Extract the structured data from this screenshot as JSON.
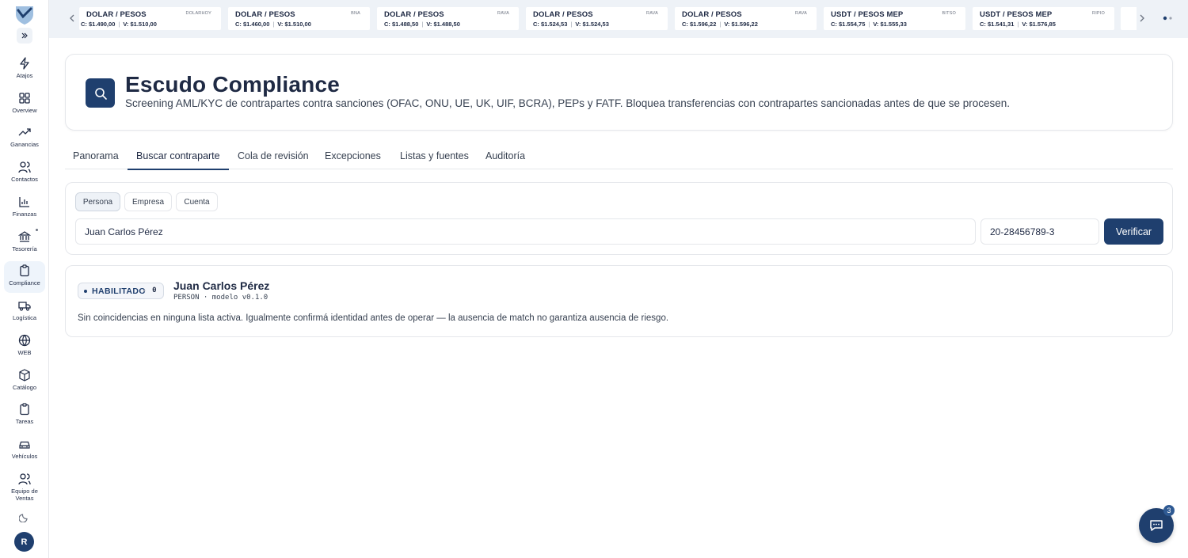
{
  "app": {
    "avatar_initial": "R",
    "accent": "#1f3f6e"
  },
  "sidebar": {
    "items": [
      {
        "label": "Atajos",
        "icon": "bolt-icon"
      },
      {
        "label": "Overview",
        "icon": "grid-icon"
      },
      {
        "label": "Ganancias",
        "icon": "trend-up-icon"
      },
      {
        "label": "Contactos",
        "icon": "users-icon"
      },
      {
        "label": "Finanzas",
        "icon": "bar-chart-icon"
      },
      {
        "label": "Tesorería",
        "icon": "bank-icon"
      },
      {
        "label": "Compliance",
        "icon": "clipboard-icon",
        "active": true
      },
      {
        "label": "Logística",
        "icon": "truck-icon"
      },
      {
        "label": "WEB",
        "icon": "globe-icon"
      },
      {
        "label": "Catálogo",
        "icon": "box-icon"
      },
      {
        "label": "Tareas",
        "icon": "clipboard-icon"
      },
      {
        "label": "Vehículos",
        "icon": "car-icon"
      },
      {
        "label": "Equipo de Ventas",
        "icon": "users-icon"
      }
    ]
  },
  "ticker": [
    {
      "pair": "DOLAR / PESOS",
      "source": "dolarhoy",
      "buy": "C: $1.490,00",
      "sell": "V: $1.510,00"
    },
    {
      "pair": "DOLAR / PESOS",
      "source": "bna",
      "buy": "C: $1.460,00",
      "sell": "V: $1.510,00"
    },
    {
      "pair": "DOLAR / PESOS",
      "source": "rava",
      "buy": "C: $1.488,50",
      "sell": "V: $1.488,50"
    },
    {
      "pair": "DOLAR / PESOS",
      "source": "rava",
      "buy": "C: $1.524,53",
      "sell": "V: $1.524,53"
    },
    {
      "pair": "DOLAR / PESOS",
      "source": "rava",
      "buy": "C: $1.596,22",
      "sell": "V: $1.596,22"
    },
    {
      "pair": "USDT / PESOS MEP",
      "source": "bitso",
      "buy": "C: $1.554,75",
      "sell": "V: $1.555,33"
    },
    {
      "pair": "USDT / PESOS MEP",
      "source": "ripio",
      "buy": "C: $1.541,31",
      "sell": "V: $1.576,85"
    }
  ],
  "header": {
    "title": "Escudo Compliance",
    "subtitle": "Screening AML/KYC de contrapartes contra sanciones (OFAC, ONU, UE, UK, UIF, BCRA), PEPs y FATF. Bloquea transferencias con contrapartes sancionadas antes de que se procesen."
  },
  "tabs": [
    "Panorama",
    "Buscar contraparte",
    "Cola de revisión",
    "Excepciones",
    "Listas y fuentes",
    "Auditoría"
  ],
  "search": {
    "types": [
      "Persona",
      "Empresa",
      "Cuenta"
    ],
    "name_value": "Juan Carlos Pérez",
    "id_value": "20-28456789-3",
    "verify_label": "Verificar"
  },
  "result": {
    "status": "HABILITADO",
    "score": "0",
    "name": "Juan Carlos Pérez",
    "meta": "PERSON · modelo v0.1.0",
    "message": "Sin coincidencias en ninguna lista activa. Igualmente confirmá identidad antes de operar — la ausencia de match no garantiza ausencia de riesgo."
  },
  "chat": {
    "badge": "3"
  }
}
